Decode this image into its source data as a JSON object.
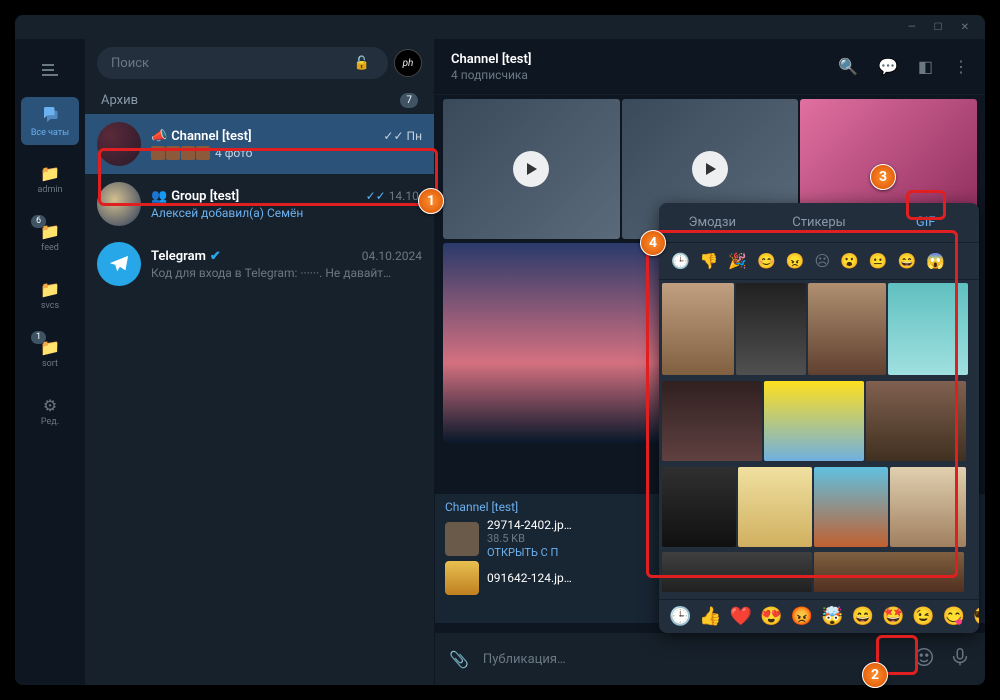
{
  "search": {
    "placeholder": "Поиск"
  },
  "rail": {
    "items": [
      {
        "label": "Все чаты"
      },
      {
        "label": "admin"
      },
      {
        "label": "feed",
        "badge": "6"
      },
      {
        "label": "svcs"
      },
      {
        "label": "sort",
        "badge": "1"
      },
      {
        "label": "Ред."
      }
    ]
  },
  "archive": {
    "label": "Архив",
    "count": "7"
  },
  "chats": [
    {
      "name": "Channel [test]",
      "preview": "4 фото",
      "time": "Пн",
      "kind": "channel"
    },
    {
      "name": "Group [test]",
      "preview": "Алексей добавил(a) Семён",
      "time": "14.10.",
      "kind": "group"
    },
    {
      "name": "Telegram",
      "preview": "Код для входа в Telegram: ······. Не давайт…",
      "time": "04.10.2024",
      "kind": "telegram"
    }
  ],
  "header": {
    "title": "Channel [test]",
    "subtitle": "4 подписчика"
  },
  "pinned": {
    "title": "Channel [test]",
    "files": [
      {
        "name": "29714-2402.jp…",
        "size": "38.5 KB",
        "open": "ОТКРЫТЬ С П"
      },
      {
        "name": "091642-124.jp…",
        "size": ""
      }
    ]
  },
  "composer": {
    "placeholder": "Публикация…"
  },
  "emoji_panel": {
    "tabs": [
      {
        "label": "Эмодзи"
      },
      {
        "label": "Стикеры"
      },
      {
        "label": "GIF"
      }
    ],
    "quick": [
      "👍",
      "❤️",
      "😍",
      "😡",
      "🤯",
      "😄",
      "🤩",
      "😉",
      "😋",
      "😎",
      "👎"
    ]
  },
  "annotations": [
    "1",
    "2",
    "3",
    "4"
  ]
}
